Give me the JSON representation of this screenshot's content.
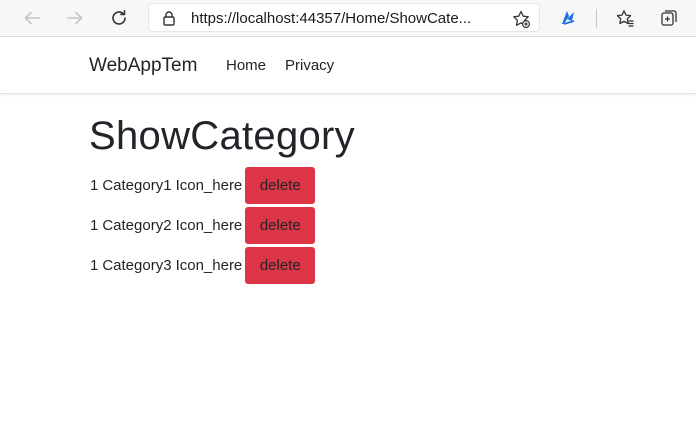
{
  "browser": {
    "url": "https://localhost:44357/Home/ShowCate...",
    "icons": {
      "back": "back-arrow-icon",
      "forward": "forward-arrow-icon",
      "refresh": "refresh-icon",
      "lock": "lock-icon",
      "add_favorite": "add-favorite-icon",
      "extension": "extension-icon",
      "favorites": "favorites-icon",
      "collections": "collections-icon"
    },
    "accent": "#1a73e8"
  },
  "navbar": {
    "brand": "WebAppTem",
    "links": [
      "Home",
      "Privacy"
    ]
  },
  "main": {
    "title": "ShowCategory",
    "categories": [
      {
        "id": "1",
        "name": "Category1",
        "icon": "Icon_here",
        "action": "delete"
      },
      {
        "id": "1",
        "name": "Category2",
        "icon": "Icon_here",
        "action": "delete"
      },
      {
        "id": "1",
        "name": "Category3",
        "icon": "Icon_here",
        "action": "delete"
      }
    ],
    "delete_color": "#dc3545"
  }
}
